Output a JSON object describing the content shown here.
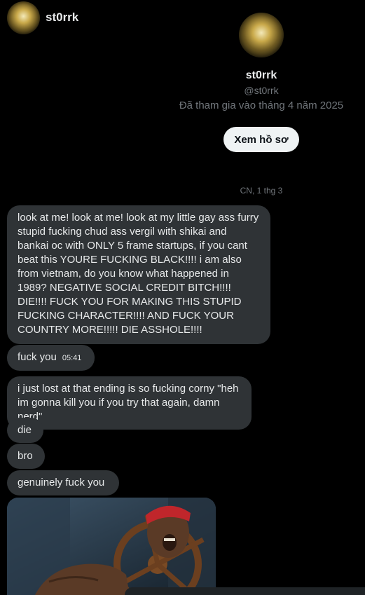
{
  "header": {
    "title": "st0rrk"
  },
  "profile": {
    "name": "st0rrk",
    "handle": "@st0rrk",
    "joined": "Đã tham gia vào tháng 4 năm 2025",
    "view_profile_label": "Xem hồ sơ"
  },
  "conversation": {
    "date_separator": "CN, 1 thg 3",
    "messages": [
      {
        "text": "look at me! look at me! look at my little gay ass furry stupid fucking chud ass vergil with shikai and bankai oc with ONLY 5 frame startups, if you cant beat this YOURE FUCKING BLACK!!!! i am also from vietnam, do you know what happened in 1989? NEGATIVE SOCIAL CREDIT BITCH!!!! DIE!!!! FUCK YOU FOR MAKING THIS STUPID FUCKING CHARACTER!!!! AND FUCK YOUR COUNTRY MORE!!!!! DIE ASSHOLE!!!!"
      },
      {
        "text": "fuck you",
        "time": "05:41"
      },
      {
        "text": "i just lost at that ending is so fucking corny \"heh im gonna kill you if you try that again, damn nerd\""
      },
      {
        "text": "die"
      },
      {
        "text": "bro"
      },
      {
        "text": "genuinely fuck you"
      }
    ]
  },
  "icons": {
    "media": "gif-image"
  }
}
